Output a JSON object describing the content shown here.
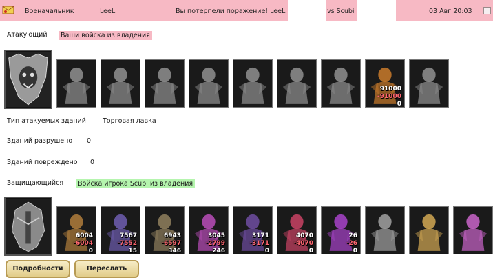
{
  "header": {
    "rank": "Военачальник",
    "player": "LeeL",
    "result": "Вы потерпели поражение! LeeL",
    "vs": "vs Scubi",
    "date": "03 Авг 20:03"
  },
  "attack": {
    "label": "Атакующий",
    "tag": "Ваши войска из владения",
    "units": [
      {
        "name": "dragon-unit-icon",
        "color": "#8a8a8a"
      },
      {
        "name": "lich-unit-icon",
        "color": "#8a8a8a"
      },
      {
        "name": "demon-warrior-unit-icon",
        "color": "#8a8a8a"
      },
      {
        "name": "beast-unit-icon",
        "color": "#8a8a8a"
      },
      {
        "name": "golem-unit-icon",
        "color": "#8a8a8a"
      },
      {
        "name": "ogre-unit-icon",
        "color": "#8a8a8a"
      },
      {
        "name": "ghost-knight-unit-icon",
        "color": "#8a8a8a"
      },
      {
        "name": "golden-knight-unit-icon",
        "color": "#c0762a",
        "n1": "91000",
        "n2": "-91000",
        "n3": "0"
      },
      {
        "name": "wraith-unit-icon",
        "color": "#8a8a8a"
      }
    ]
  },
  "info": {
    "building_type_label": "Тип атакуемых зданий",
    "building_type_value": "Торговая лавка",
    "destroyed_label": "Зданий разрушено",
    "destroyed_value": "0",
    "damaged_label": "Зданий повреждено",
    "damaged_value": "0"
  },
  "defense": {
    "label": "Защищающийся",
    "tag": "Войска игрока Scubi из владения",
    "units": [
      {
        "name": "troll-unit-icon",
        "color": "#a8783a",
        "n1": "6004",
        "n2": "-6004",
        "n3": "0"
      },
      {
        "name": "dwarf-unit-icon",
        "color": "#6a5aa8",
        "n1": "7567",
        "n2": "-7552",
        "n3": "15"
      },
      {
        "name": "lizard-warrior-unit-icon",
        "color": "#8a7a5a",
        "n1": "6943",
        "n2": "-6597",
        "n3": "346"
      },
      {
        "name": "winged-mage-unit-icon",
        "color": "#b04ab0",
        "n1": "3045",
        "n2": "-2799",
        "n3": "246"
      },
      {
        "name": "archer-unit-icon",
        "color": "#6a4a9a",
        "n1": "3171",
        "n2": "-3171",
        "n3": "0"
      },
      {
        "name": "sorcerer-unit-icon",
        "color": "#c04060",
        "n1": "4070",
        "n2": "-4070",
        "n3": "0"
      },
      {
        "name": "assassin-unit-icon",
        "color": "#a040c0",
        "n1": "26",
        "n2": "-26",
        "n3": "0"
      },
      {
        "name": "spider-unit-icon",
        "color": "#9a9a9a"
      },
      {
        "name": "turtle-unit-icon",
        "color": "#c8a050"
      },
      {
        "name": "pod-unit-icon",
        "color": "#c060c0"
      }
    ]
  },
  "buttons": {
    "details": "Подробности",
    "forward": "Переслать"
  }
}
